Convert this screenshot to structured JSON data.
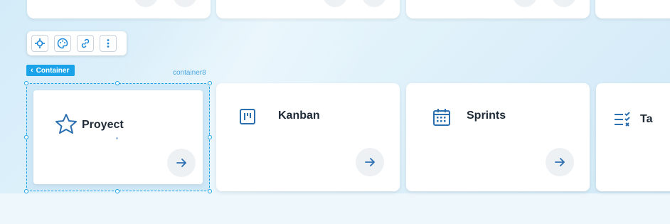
{
  "toolbar": {
    "icons": [
      "move-icon",
      "palette-icon",
      "link-icon",
      "more-vertical-icon"
    ]
  },
  "container_tag": {
    "label": "Container",
    "id": "container8"
  },
  "cards": [
    {
      "title": "Proyect",
      "icon": "star-icon"
    },
    {
      "title": "Kanban",
      "icon": "kanban-icon"
    },
    {
      "title": "Sprints",
      "icon": "calendar-icon"
    },
    {
      "title": "Ta",
      "icon": "checklist-icon"
    }
  ],
  "colors": {
    "accent": "#1aa3e8",
    "icon": "#2b6fb1",
    "title": "#1f2a37"
  }
}
